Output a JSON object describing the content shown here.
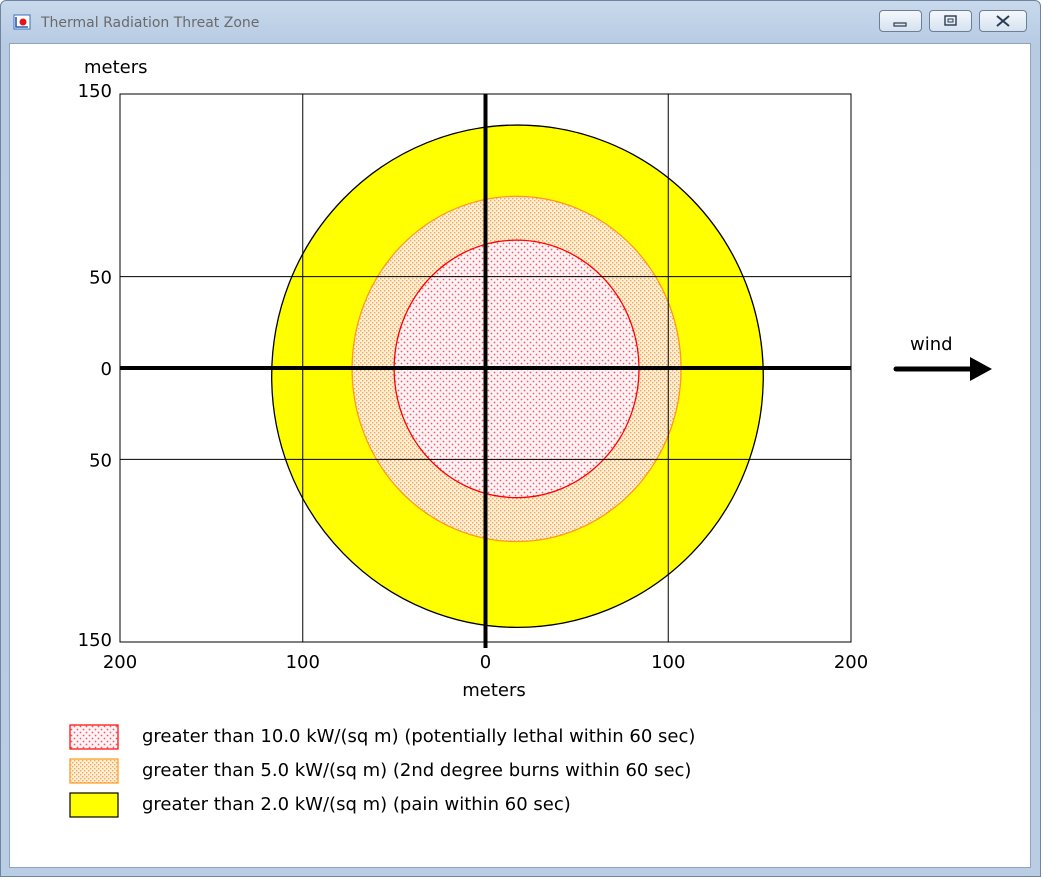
{
  "window": {
    "title": "Thermal Radiation Threat Zone",
    "icon": "app-chart-icon",
    "controls": [
      "minimize-icon",
      "restore-icon",
      "close-icon"
    ]
  },
  "chart_data": {
    "type": "threat-zone-contour",
    "x": {
      "label": "meters",
      "range": [
        -200,
        200
      ],
      "tick_values": [
        -200,
        -100,
        0,
        100,
        200
      ],
      "tick_labels": [
        "200",
        "100",
        "0",
        "100",
        "200"
      ]
    },
    "y": {
      "label": "meters",
      "range": [
        -150,
        150
      ],
      "tick_values": [
        150,
        50,
        0,
        -50,
        -150
      ],
      "tick_labels": [
        "150",
        "50",
        "0",
        "50",
        "150"
      ]
    },
    "grid": true,
    "wind": {
      "label": "wind",
      "direction": "east"
    },
    "zones": [
      {
        "name": "pain",
        "color": "#ffff00",
        "stroke": "#000000",
        "pattern": "solid",
        "x_extent": [
          -117,
          152
        ],
        "y_extent": [
          -142,
          133
        ],
        "center": [
          17,
          -5
        ]
      },
      {
        "name": "2nd-degree",
        "color": "#ffdfa8",
        "stroke": "#ff9a1a",
        "pattern": "dotted",
        "x_extent": [
          -73,
          107
        ],
        "y_extent": [
          -95,
          94
        ],
        "center": [
          17,
          -1
        ]
      },
      {
        "name": "lethal",
        "color": "#ffe2e6",
        "stroke": "#ff0000",
        "pattern": "dotted",
        "x_extent": [
          -50,
          84
        ],
        "y_extent": [
          -71,
          70
        ],
        "center": [
          17,
          -1
        ]
      }
    ],
    "legend": [
      {
        "text": "greater than 10.0 kW/(sq m) (potentially lethal within 60 sec)",
        "fill": "#ffe2e6",
        "stroke": "#ff0000",
        "pattern": "dotted-red"
      },
      {
        "text": "greater than 5.0 kW/(sq m) (2nd degree burns within 60 sec)",
        "fill": "#ffdfa8",
        "stroke": "#ff9a1a",
        "pattern": "dotted-orange"
      },
      {
        "text": "greater than 2.0 kW/(sq m) (pain within 60 sec)",
        "fill": "#ffff00",
        "stroke": "#000000",
        "pattern": "solid"
      }
    ]
  }
}
